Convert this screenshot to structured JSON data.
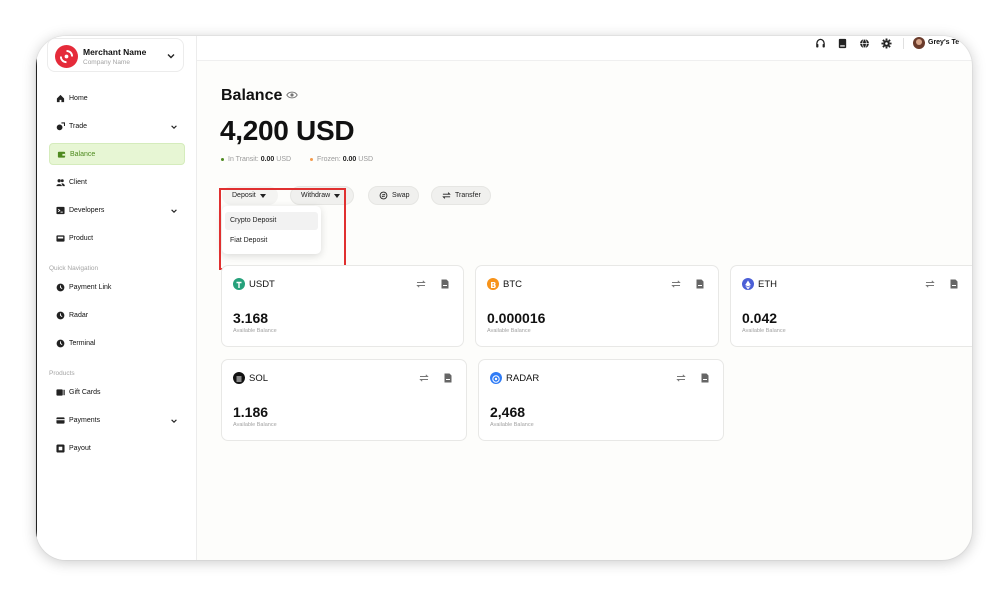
{
  "merchant": {
    "name": "Merchant Name",
    "company": "Company Name"
  },
  "sidebar": {
    "items": [
      {
        "label": "Home",
        "icon": "home-icon"
      },
      {
        "label": "Trade",
        "icon": "trade-icon",
        "expandable": true
      },
      {
        "label": "Balance",
        "icon": "wallet-icon",
        "active": true
      },
      {
        "label": "Client",
        "icon": "users-icon"
      },
      {
        "label": "Developers",
        "icon": "terminal-icon",
        "expandable": true
      },
      {
        "label": "Product",
        "icon": "product-icon"
      }
    ],
    "quick_nav_label": "Quick Navigation",
    "quick_nav": [
      {
        "label": "Payment Link",
        "icon": "link-icon"
      },
      {
        "label": "Radar",
        "icon": "radar-icon"
      },
      {
        "label": "Terminal",
        "icon": "terminal-icon"
      }
    ],
    "products_label": "Products",
    "products": [
      {
        "label": "Gift Cards",
        "icon": "gift-card-icon"
      },
      {
        "label": "Payments",
        "icon": "payments-icon",
        "expandable": true
      },
      {
        "label": "Payout",
        "icon": "payout-icon"
      }
    ]
  },
  "topbar": {
    "icons": [
      "headset-icon",
      "book-icon",
      "globe-icon",
      "gear-icon"
    ],
    "user_name": "Grey's Te"
  },
  "balance": {
    "title": "Balance",
    "amount": "4,200 USD",
    "in_transit_label": "In Transit:",
    "in_transit_value": "0.00",
    "in_transit_unit": "USD",
    "frozen_label": "Frozen:",
    "frozen_value": "0.00",
    "frozen_unit": "USD"
  },
  "actions": {
    "deposit": "Deposit",
    "withdraw": "Withdraw",
    "swap": "Swap",
    "transfer": "Transfer"
  },
  "deposit_menu": [
    "Crypto Deposit",
    "Fiat Deposit"
  ],
  "colors": {
    "accent_green": "#4e8a1f",
    "active_bg": "#e7f6d4",
    "highlight_red": "#e03030",
    "usdt": "#26a17b",
    "btc": "#f7931a",
    "eth": "#4b5fd6",
    "sol": "#111111",
    "radar": "#2f7cf6"
  },
  "assets": [
    {
      "symbol": "USDT",
      "value": "3.168",
      "label": "Available Balance"
    },
    {
      "symbol": "BTC",
      "value": "0.000016",
      "label": "Available Balance"
    },
    {
      "symbol": "ETH",
      "value": "0.042",
      "label": "Available Balance"
    },
    {
      "symbol": "SOL",
      "value": "1.186",
      "label": "Available Balance"
    },
    {
      "symbol": "RADAR",
      "value": "2,468",
      "label": "Available Balance"
    }
  ]
}
